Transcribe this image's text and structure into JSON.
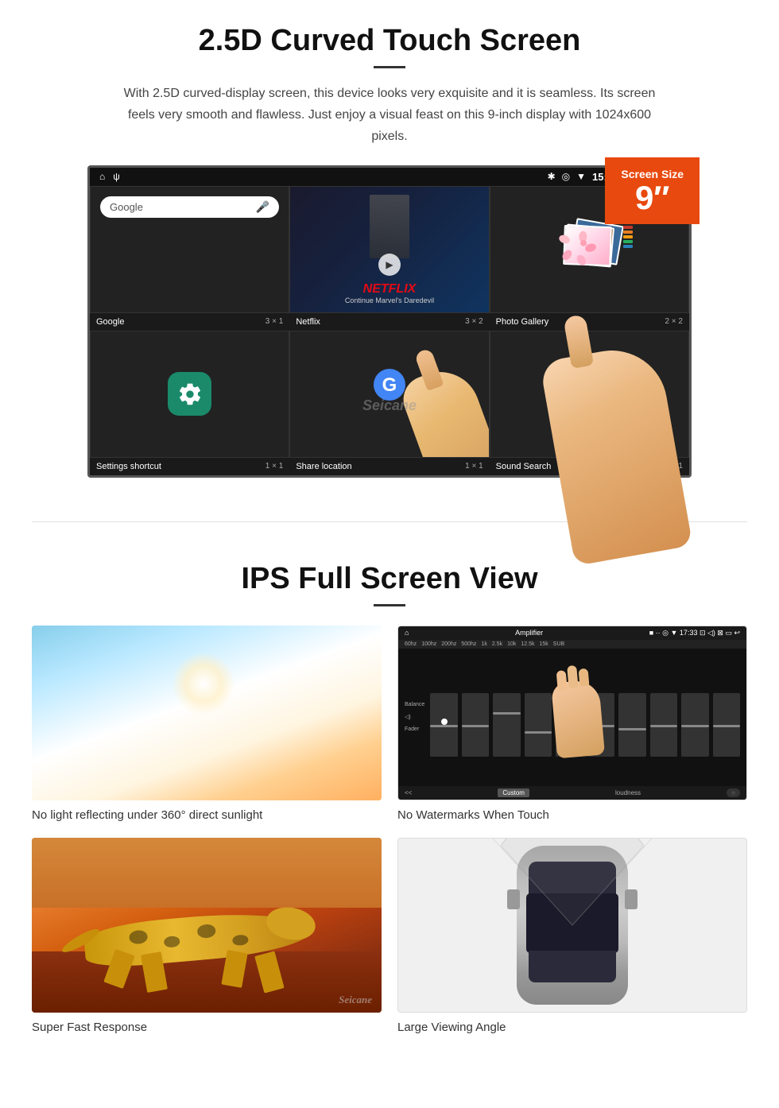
{
  "section1": {
    "title": "2.5D Curved Touch Screen",
    "description": "With 2.5D curved-display screen, this device looks very exquisite and it is seamless. Its screen feels very smooth and flawless. Just enjoy a visual feast on this 9-inch display with 1024x600 pixels.",
    "badge_label": "Screen Size",
    "badge_size": "9″",
    "status_bar": {
      "time": "15:06",
      "icons_left": [
        "home",
        "usb"
      ],
      "icons_right": [
        "bluetooth",
        "location",
        "wifi",
        "time",
        "camera",
        "volume",
        "close",
        "window"
      ]
    },
    "apps": [
      {
        "name": "Google",
        "size": "3 × 1",
        "type": "google"
      },
      {
        "name": "Netflix",
        "size": "3 × 2",
        "type": "netflix"
      },
      {
        "name": "Photo Gallery",
        "size": "2 × 2",
        "type": "gallery"
      },
      {
        "name": "Settings shortcut",
        "size": "1 × 1",
        "type": "settings"
      },
      {
        "name": "Share location",
        "size": "1 × 1",
        "type": "share"
      },
      {
        "name": "Sound Search",
        "size": "1 × 1",
        "type": "sound"
      }
    ],
    "netflix_text": "NETFLIX",
    "netflix_subtext": "Continue Marvel's Daredevil",
    "watermark": "Seicane"
  },
  "section2": {
    "title": "IPS Full Screen View",
    "features": [
      {
        "caption": "No light reflecting under 360° direct sunlight",
        "type": "sunlight"
      },
      {
        "caption": "No Watermarks When Touch",
        "type": "amplifier"
      },
      {
        "caption": "Super Fast Response",
        "type": "cheetah"
      },
      {
        "caption": "Large Viewing Angle",
        "type": "car"
      }
    ],
    "watermark": "Seicane"
  }
}
